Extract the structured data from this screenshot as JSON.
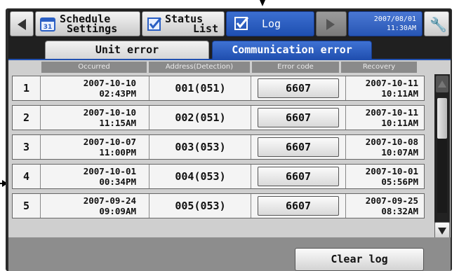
{
  "nav": {
    "schedule_label_1": "Schedule",
    "schedule_label_2": "Settings",
    "schedule_day": "31",
    "status_label_1": "Status",
    "status_label_2": "List",
    "log_label": "Log",
    "date": "2007/08/01",
    "time": "11:30AM"
  },
  "tabs": [
    {
      "label": "Unit error",
      "active": false
    },
    {
      "label": "Communication error",
      "active": true
    }
  ],
  "table": {
    "headers": [
      "Occurred",
      "Address(Detection)",
      "Error code",
      "Recovery"
    ],
    "rows": [
      {
        "num": "1",
        "occ_date": "2007-10-10",
        "occ_time": "02:43PM",
        "address": "001(051)",
        "code": "6607",
        "rec_date": "2007-10-11",
        "rec_time": "10:11AM"
      },
      {
        "num": "2",
        "occ_date": "2007-10-10",
        "occ_time": "11:15AM",
        "address": "002(051)",
        "code": "6607",
        "rec_date": "2007-10-11",
        "rec_time": "10:11AM"
      },
      {
        "num": "3",
        "occ_date": "2007-10-07",
        "occ_time": "11:00PM",
        "address": "003(053)",
        "code": "6607",
        "rec_date": "2007-10-08",
        "rec_time": "10:07AM"
      },
      {
        "num": "4",
        "occ_date": "2007-10-01",
        "occ_time": "00:34PM",
        "address": "004(053)",
        "code": "6607",
        "rec_date": "2007-10-01",
        "rec_time": "05:56PM"
      },
      {
        "num": "5",
        "occ_date": "2007-09-24",
        "occ_time": "09:09AM",
        "address": "005(053)",
        "code": "6607",
        "rec_date": "2007-09-25",
        "rec_time": "08:32AM"
      }
    ]
  },
  "footer": {
    "clear_label": "Clear log"
  },
  "colors": {
    "accent": "#2150b0",
    "panel": "#cfcfcf"
  }
}
